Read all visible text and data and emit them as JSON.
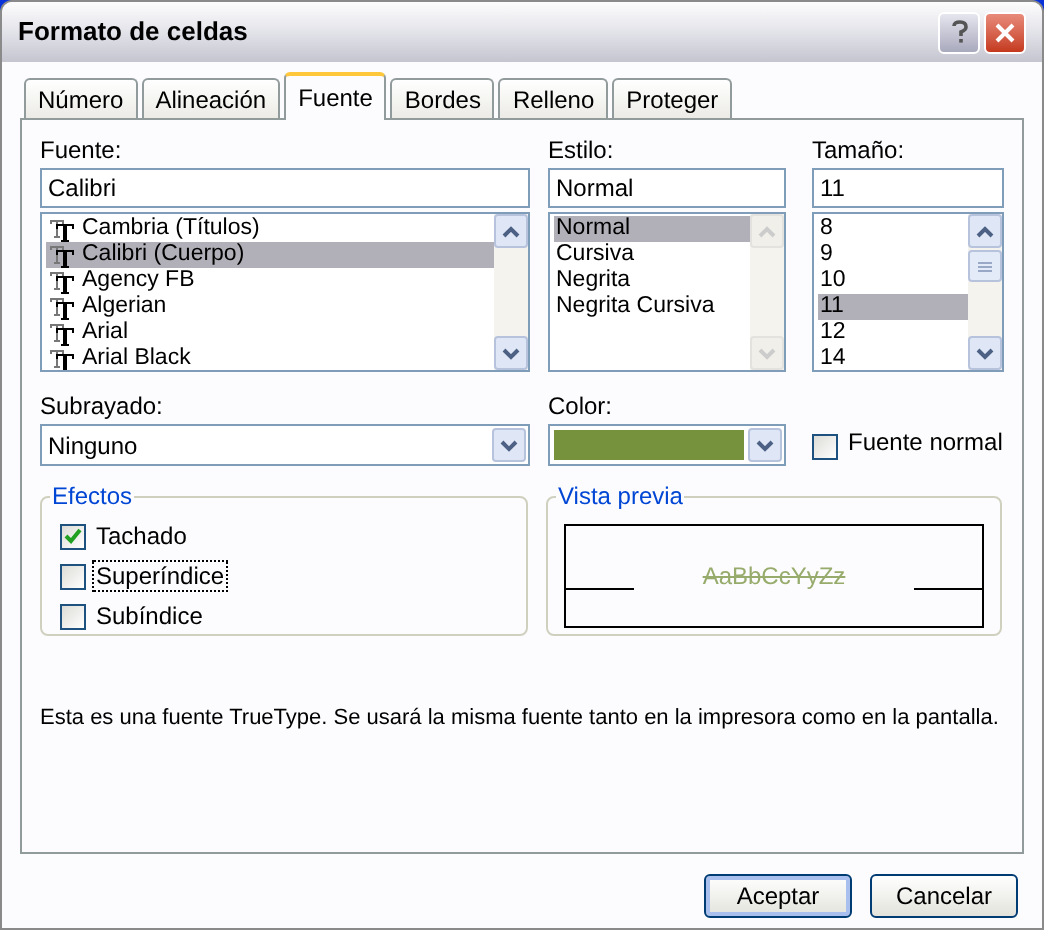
{
  "window": {
    "title": "Formato de celdas"
  },
  "tabs": [
    {
      "label": "Número",
      "selected": false
    },
    {
      "label": "Alineación",
      "selected": false
    },
    {
      "label": "Fuente",
      "selected": true
    },
    {
      "label": "Bordes",
      "selected": false
    },
    {
      "label": "Relleno",
      "selected": false
    },
    {
      "label": "Proteger",
      "selected": false
    }
  ],
  "font": {
    "label": "Fuente:",
    "value": "Calibri",
    "items": [
      {
        "label": "Cambria (Títulos)",
        "selected": false
      },
      {
        "label": "Calibri (Cuerpo)",
        "selected": true
      },
      {
        "label": "Agency FB",
        "selected": false
      },
      {
        "label": "Algerian",
        "selected": false
      },
      {
        "label": "Arial",
        "selected": false
      },
      {
        "label": "Arial Black",
        "selected": false
      }
    ]
  },
  "style": {
    "label": "Estilo:",
    "value": "Normal",
    "items": [
      {
        "label": "Normal",
        "selected": true
      },
      {
        "label": "Cursiva",
        "selected": false
      },
      {
        "label": "Negrita",
        "selected": false
      },
      {
        "label": "Negrita Cursiva",
        "selected": false
      }
    ]
  },
  "size": {
    "label": "Tamaño:",
    "value": "11",
    "items": [
      {
        "label": "8",
        "selected": false
      },
      {
        "label": "9",
        "selected": false
      },
      {
        "label": "10",
        "selected": false
      },
      {
        "label": "11",
        "selected": true
      },
      {
        "label": "12",
        "selected": false
      },
      {
        "label": "14",
        "selected": false
      }
    ]
  },
  "underline": {
    "label": "Subrayado:",
    "value": "Ninguno"
  },
  "color": {
    "label": "Color:",
    "color": "#76923c"
  },
  "normal_font": {
    "label": "Fuente normal",
    "checked": false
  },
  "effects": {
    "title": "Efectos",
    "items": [
      {
        "label": "Tachado",
        "checked": true,
        "focused": false
      },
      {
        "label": "Superíndice",
        "checked": false,
        "focused": true
      },
      {
        "label": "Subíndice",
        "checked": false,
        "focused": false
      }
    ]
  },
  "preview": {
    "title": "Vista previa",
    "sample": "AaBbCcYyZz"
  },
  "info": "Esta es una fuente TrueType. Se usará la misma fuente tanto en la impresora como en la pantalla.",
  "buttons": [
    {
      "label": "Aceptar",
      "default": true
    },
    {
      "label": "Cancelar",
      "default": false
    }
  ]
}
